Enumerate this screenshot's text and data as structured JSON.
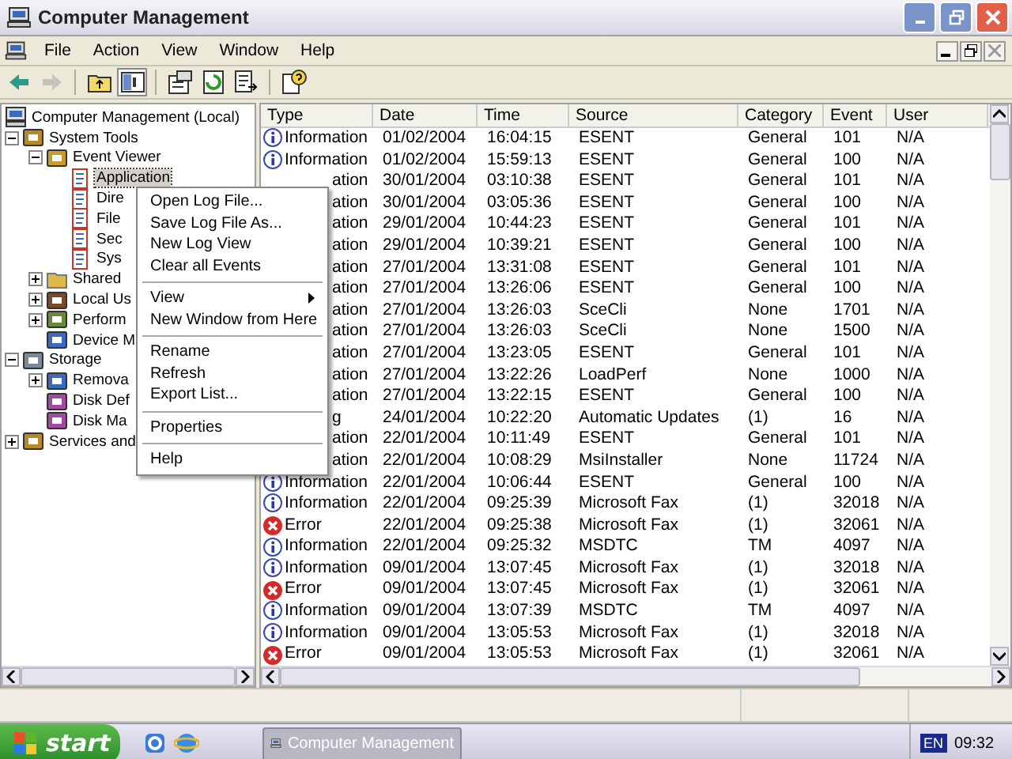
{
  "window": {
    "title": "Computer Management"
  },
  "menu_bar": [
    "File",
    "Action",
    "View",
    "Window",
    "Help"
  ],
  "toolbar": [
    {
      "kind": "back",
      "disabled": false
    },
    {
      "kind": "forward",
      "disabled": true
    },
    {
      "kind": "up",
      "disabled": false
    },
    {
      "kind": "tree",
      "disabled": false
    },
    {
      "kind": "properties",
      "disabled": false
    },
    {
      "kind": "refresh",
      "disabled": false
    },
    {
      "kind": "export",
      "disabled": false
    },
    {
      "kind": "help",
      "disabled": false
    }
  ],
  "tree": [
    {
      "label": "Computer Management (Local)",
      "kind": "computer",
      "selected": false,
      "children": [
        {
          "label": "System Tools",
          "kind": "tools",
          "selected": false,
          "expanded": true,
          "children": [
            {
              "label": "Event Viewer",
              "kind": "viewer",
              "selected": false,
              "expanded": true,
              "children": [
                {
                  "label": "Application",
                  "kind": "log",
                  "selected": true
                },
                {
                  "label": "Dire",
                  "kind": "log",
                  "selected": false
                },
                {
                  "label": "File",
                  "kind": "log",
                  "selected": false
                },
                {
                  "label": "Sec",
                  "kind": "log",
                  "selected": false
                },
                {
                  "label": "Sys",
                  "kind": "log",
                  "selected": false
                }
              ]
            },
            {
              "label": "Shared",
              "kind": "folder",
              "selected": false,
              "expanded": false
            },
            {
              "label": "Local Us",
              "kind": "users",
              "selected": false,
              "expanded": false
            },
            {
              "label": "Perform",
              "kind": "perf",
              "selected": false,
              "expanded": false
            },
            {
              "label": "Device M",
              "kind": "device",
              "selected": false
            }
          ]
        },
        {
          "label": "Storage",
          "kind": "storage",
          "selected": false,
          "expanded": true,
          "children": [
            {
              "label": "Remova",
              "kind": "device",
              "selected": false,
              "expanded": false
            },
            {
              "label": "Disk Def",
              "kind": "disk",
              "selected": false
            },
            {
              "label": "Disk Ma",
              "kind": "disk",
              "selected": false
            }
          ]
        },
        {
          "label": "Services and",
          "kind": "tools",
          "selected": false,
          "expanded": false
        }
      ]
    }
  ],
  "table": {
    "columns": [
      "Type",
      "Date",
      "Time",
      "Source",
      "Category",
      "Event",
      "User"
    ],
    "rows": [
      {
        "kind": "info",
        "type": "Information",
        "date": "01/02/2004",
        "time": "16:04:15",
        "source": "ESENT",
        "category": "General",
        "event": "101",
        "user": "N/A"
      },
      {
        "kind": "info",
        "type": "Information",
        "date": "01/02/2004",
        "time": "15:59:13",
        "source": "ESENT",
        "category": "General",
        "event": "100",
        "user": "N/A"
      },
      {
        "covered": true,
        "type": "ation",
        "date": "30/01/2004",
        "time": "03:10:38",
        "source": "ESENT",
        "category": "General",
        "event": "101",
        "user": "N/A"
      },
      {
        "covered": true,
        "type": "ation",
        "date": "30/01/2004",
        "time": "03:05:36",
        "source": "ESENT",
        "category": "General",
        "event": "100",
        "user": "N/A"
      },
      {
        "covered": true,
        "type": "ation",
        "date": "29/01/2004",
        "time": "10:44:23",
        "source": "ESENT",
        "category": "General",
        "event": "101",
        "user": "N/A"
      },
      {
        "covered": true,
        "type": "ation",
        "date": "29/01/2004",
        "time": "10:39:21",
        "source": "ESENT",
        "category": "General",
        "event": "100",
        "user": "N/A"
      },
      {
        "covered": true,
        "type": "ation",
        "date": "27/01/2004",
        "time": "13:31:08",
        "source": "ESENT",
        "category": "General",
        "event": "101",
        "user": "N/A"
      },
      {
        "covered": true,
        "type": "ation",
        "date": "27/01/2004",
        "time": "13:26:06",
        "source": "ESENT",
        "category": "General",
        "event": "100",
        "user": "N/A"
      },
      {
        "covered": true,
        "type": "ation",
        "date": "27/01/2004",
        "time": "13:26:03",
        "source": "SceCli",
        "category": "None",
        "event": "1701",
        "user": "N/A"
      },
      {
        "covered": true,
        "type": "ation",
        "date": "27/01/2004",
        "time": "13:26:03",
        "source": "SceCli",
        "category": "None",
        "event": "1500",
        "user": "N/A"
      },
      {
        "covered": true,
        "type": "ation",
        "date": "27/01/2004",
        "time": "13:23:05",
        "source": "ESENT",
        "category": "General",
        "event": "101",
        "user": "N/A"
      },
      {
        "covered": true,
        "type": "ation",
        "date": "27/01/2004",
        "time": "13:22:26",
        "source": "LoadPerf",
        "category": "None",
        "event": "1000",
        "user": "N/A"
      },
      {
        "covered": true,
        "type": "ation",
        "date": "27/01/2004",
        "time": "13:22:15",
        "source": "ESENT",
        "category": "General",
        "event": "100",
        "user": "N/A"
      },
      {
        "covered": true,
        "type": "g",
        "date": "24/01/2004",
        "time": "10:22:20",
        "source": "Automatic Updates",
        "category": "(1)",
        "event": "16",
        "user": "N/A"
      },
      {
        "covered": true,
        "type": "ation",
        "date": "22/01/2004",
        "time": "10:11:49",
        "source": "ESENT",
        "category": "General",
        "event": "101",
        "user": "N/A"
      },
      {
        "covered": true,
        "type": "ation",
        "date": "22/01/2004",
        "time": "10:08:29",
        "source": "MsiInstaller",
        "category": "None",
        "event": "11724",
        "user": "N/A"
      },
      {
        "kind": "info",
        "type": "Information",
        "date": "22/01/2004",
        "time": "10:06:44",
        "source": "ESENT",
        "category": "General",
        "event": "100",
        "user": "N/A"
      },
      {
        "kind": "info",
        "type": "Information",
        "date": "22/01/2004",
        "time": "09:25:39",
        "source": "Microsoft Fax",
        "category": "(1)",
        "event": "32018",
        "user": "N/A"
      },
      {
        "kind": "error",
        "type": "Error",
        "date": "22/01/2004",
        "time": "09:25:38",
        "source": "Microsoft Fax",
        "category": "(1)",
        "event": "32061",
        "user": "N/A"
      },
      {
        "kind": "info",
        "type": "Information",
        "date": "22/01/2004",
        "time": "09:25:32",
        "source": "MSDTC",
        "category": "TM",
        "event": "4097",
        "user": "N/A"
      },
      {
        "kind": "info",
        "type": "Information",
        "date": "09/01/2004",
        "time": "13:07:45",
        "source": "Microsoft Fax",
        "category": "(1)",
        "event": "32018",
        "user": "N/A"
      },
      {
        "kind": "error",
        "type": "Error",
        "date": "09/01/2004",
        "time": "13:07:45",
        "source": "Microsoft Fax",
        "category": "(1)",
        "event": "32061",
        "user": "N/A"
      },
      {
        "kind": "info",
        "type": "Information",
        "date": "09/01/2004",
        "time": "13:07:39",
        "source": "MSDTC",
        "category": "TM",
        "event": "4097",
        "user": "N/A"
      },
      {
        "kind": "info",
        "type": "Information",
        "date": "09/01/2004",
        "time": "13:05:53",
        "source": "Microsoft Fax",
        "category": "(1)",
        "event": "32018",
        "user": "N/A"
      },
      {
        "kind": "error",
        "type": "Error",
        "date": "09/01/2004",
        "time": "13:05:53",
        "source": "Microsoft Fax",
        "category": "(1)",
        "event": "32061",
        "user": "N/A"
      }
    ]
  },
  "context_menu": [
    {
      "kind": "item",
      "label": "Open Log File..."
    },
    {
      "kind": "item",
      "label": "Save Log File As..."
    },
    {
      "kind": "item",
      "label": "New Log View"
    },
    {
      "kind": "item",
      "label": "Clear all Events"
    },
    {
      "kind": "separator"
    },
    {
      "kind": "submenu",
      "label": "View"
    },
    {
      "kind": "item",
      "label": "New Window from Here"
    },
    {
      "kind": "separator"
    },
    {
      "kind": "item",
      "label": "Rename"
    },
    {
      "kind": "item",
      "label": "Refresh"
    },
    {
      "kind": "item",
      "label": "Export List..."
    },
    {
      "kind": "separator"
    },
    {
      "kind": "item",
      "label": "Properties"
    },
    {
      "kind": "separator"
    },
    {
      "kind": "item",
      "label": "Help"
    }
  ],
  "taskbar": {
    "start": "start",
    "tasks": [
      {
        "label": "Computer Management",
        "selected": true
      }
    ],
    "language": "EN",
    "clock": "09:32"
  }
}
